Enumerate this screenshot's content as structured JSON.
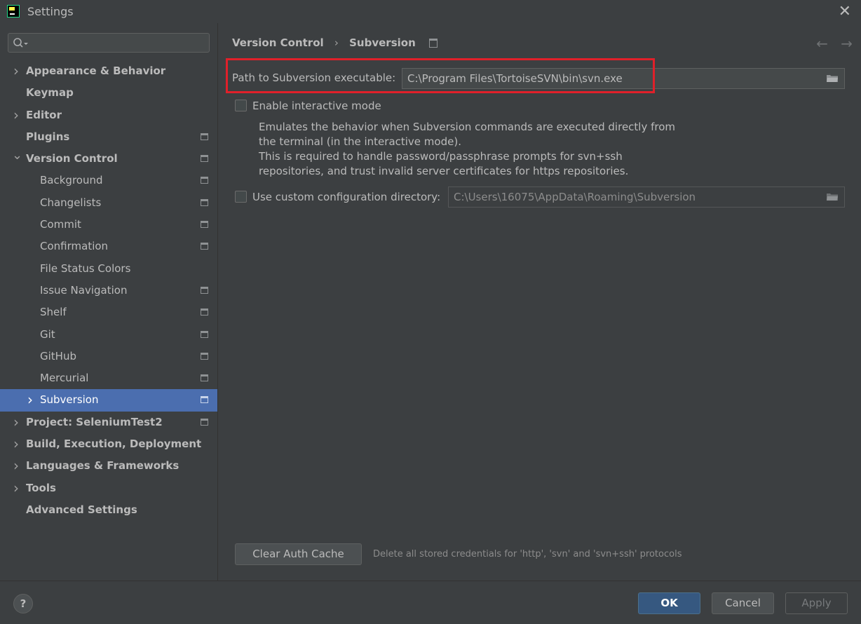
{
  "window": {
    "title": "Settings"
  },
  "sidebar": {
    "search_placeholder": "",
    "items": [
      {
        "label": "Appearance & Behavior",
        "level": 0,
        "chevron": "right",
        "project": false
      },
      {
        "label": "Keymap",
        "level": 0,
        "chevron": "",
        "project": false
      },
      {
        "label": "Editor",
        "level": 0,
        "chevron": "right",
        "project": false
      },
      {
        "label": "Plugins",
        "level": 0,
        "chevron": "",
        "project": true
      },
      {
        "label": "Version Control",
        "level": 0,
        "chevron": "down",
        "project": true
      },
      {
        "label": "Background",
        "level": 1,
        "chevron": "",
        "project": true
      },
      {
        "label": "Changelists",
        "level": 1,
        "chevron": "",
        "project": true
      },
      {
        "label": "Commit",
        "level": 1,
        "chevron": "",
        "project": true
      },
      {
        "label": "Confirmation",
        "level": 1,
        "chevron": "",
        "project": true
      },
      {
        "label": "File Status Colors",
        "level": 1,
        "chevron": "",
        "project": false
      },
      {
        "label": "Issue Navigation",
        "level": 1,
        "chevron": "",
        "project": true
      },
      {
        "label": "Shelf",
        "level": 1,
        "chevron": "",
        "project": true
      },
      {
        "label": "Git",
        "level": 1,
        "chevron": "",
        "project": true
      },
      {
        "label": "GitHub",
        "level": 1,
        "chevron": "",
        "project": true
      },
      {
        "label": "Mercurial",
        "level": 1,
        "chevron": "",
        "project": true
      },
      {
        "label": "Subversion",
        "level": 1,
        "chevron": "right",
        "project": true,
        "selected": true
      },
      {
        "label": "Project: SeleniumTest2",
        "level": 0,
        "chevron": "right",
        "project": true
      },
      {
        "label": "Build, Execution, Deployment",
        "level": 0,
        "chevron": "right",
        "project": false
      },
      {
        "label": "Languages & Frameworks",
        "level": 0,
        "chevron": "right",
        "project": false
      },
      {
        "label": "Tools",
        "level": 0,
        "chevron": "right",
        "project": false
      },
      {
        "label": "Advanced Settings",
        "level": 0,
        "chevron": "",
        "project": false
      }
    ]
  },
  "content": {
    "breadcrumb": {
      "parent": "Version Control",
      "current": "Subversion"
    },
    "path_label": "Path to Subversion executable:",
    "path_value": "C:\\Program Files\\TortoiseSVN\\bin\\svn.exe",
    "interactive_mode": {
      "label": "Enable interactive mode",
      "checked": false,
      "description": [
        "Emulates the behavior when Subversion commands are executed directly from",
        "the terminal (in the interactive mode).",
        "This is required to handle password/passphrase prompts for svn+ssh",
        "repositories, and trust invalid server certificates for https repositories."
      ]
    },
    "custom_config": {
      "label": "Use custom configuration directory:",
      "checked": false,
      "value": "C:\\Users\\16075\\AppData\\Roaming\\Subversion"
    },
    "clear_cache_label": "Clear Auth Cache",
    "clear_cache_hint": "Delete all stored credentials for 'http', 'svn' and 'svn+ssh' protocols"
  },
  "footer": {
    "help": "?",
    "ok": "OK",
    "cancel": "Cancel",
    "apply": "Apply"
  },
  "colors": {
    "accent": "#4b6eaf",
    "highlight_border": "#e0202a",
    "ok_button": "#365880"
  }
}
